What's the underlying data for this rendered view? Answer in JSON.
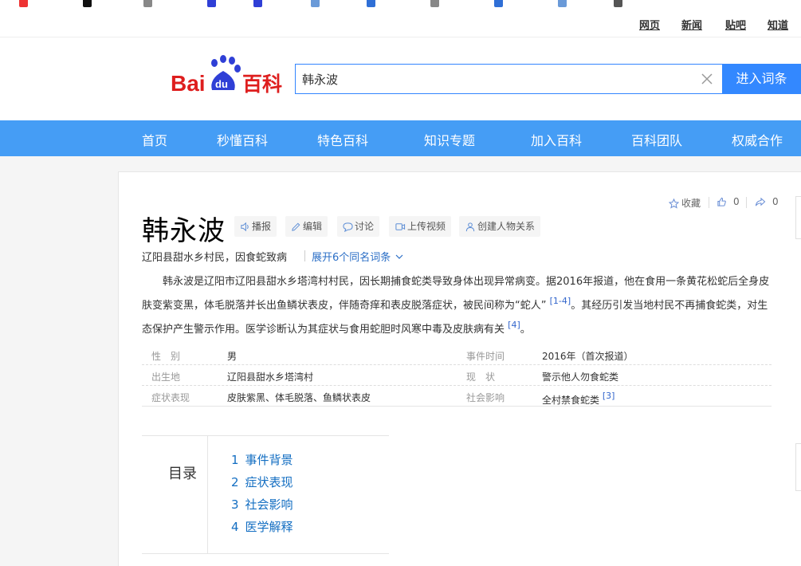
{
  "top_links": [
    "网页",
    "新闻",
    "贴吧",
    "知道"
  ],
  "logo": {
    "text_bai": "Bai",
    "text_du": "du",
    "text_baike": "百科"
  },
  "search": {
    "value": "韩永波",
    "button": "进入词条"
  },
  "nav": [
    "首页",
    "秒懂百科",
    "特色百科",
    "知识专题",
    "加入百科",
    "百科团队",
    "权威合作"
  ],
  "actions": {
    "favorite": "收藏",
    "like_count": "0",
    "share_count": "0"
  },
  "entry": {
    "title": "韩永波",
    "tools": [
      "播报",
      "编辑",
      "讨论",
      "上传视频",
      "创建人物关系"
    ],
    "subtitle": "辽阳县甜水乡村民，因食蛇致病",
    "expand": "展开6个同名词条",
    "summary_p1": "韩永波是辽阳市辽阳县甜水乡塔湾村村民，因长期捕食蛇类导致身体出现异常病变。据2016年报道，他在食用一条黄花松蛇后全身皮肤变紫变黑，体毛脱落并长出鱼鳞状表皮，伴随奇痒和表皮脱落症状，被民间称为“蛇人”",
    "ref1": "[1-4]",
    "summary_p2": "。其经历引发当地村民不再捕食蛇类，对生态保护产生警示作用。医学诊断认为其症状与食用蛇胆时风寒中毒及皮肤病有关",
    "ref2": "[4]",
    "summary_end": "。",
    "info": [
      {
        "l1": "性　别",
        "v1": "男",
        "l2": "事件时间",
        "v2": "2016年（首次报道）",
        "ref": ""
      },
      {
        "l1": "出生地",
        "v1": "辽阳县甜水乡塔湾村",
        "l2": "现　状",
        "v2": "警示他人勿食蛇类",
        "ref": ""
      },
      {
        "l1": "症状表现",
        "v1": "皮肤紫黑、体毛脱落、鱼鳞状表皮",
        "l2": "社会影响",
        "v2": "全村禁食蛇类",
        "ref": "[3]"
      }
    ],
    "toc_title": "目录",
    "toc": [
      {
        "num": "1",
        "label": "事件背景"
      },
      {
        "num": "2",
        "label": "症状表现"
      },
      {
        "num": "3",
        "label": "社会影响"
      },
      {
        "num": "4",
        "label": "医学解释"
      }
    ]
  }
}
